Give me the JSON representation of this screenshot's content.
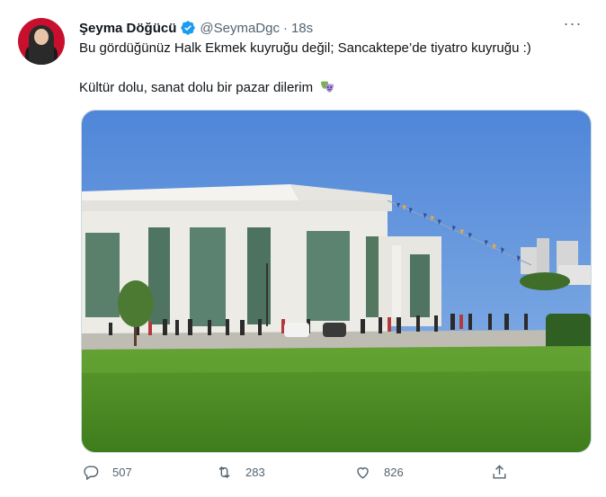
{
  "author": {
    "display_name": "Şeyma Döğücü",
    "handle": "@SeymaDgc",
    "separator": "·",
    "time": "18s"
  },
  "tweet": {
    "line1": "Bu gördüğünüz Halk Ekmek kuyruğu değil; Sancaktepe’de tiyatro kuyruğu :)",
    "line2": "Kültür dolu, sanat dolu bir pazar dilerim"
  },
  "more_label": "···",
  "stats": {
    "replies": "507",
    "retweets": "283",
    "likes": "826"
  },
  "icons": [
    "verified-badge-icon",
    "more-icon",
    "theater-masks-emoji-icon",
    "reply-icon",
    "retweet-icon",
    "like-icon",
    "share-icon"
  ],
  "colors": {
    "verified": "#1d9bf0",
    "secondary_text": "#536471",
    "primary_text": "#0f1419"
  }
}
